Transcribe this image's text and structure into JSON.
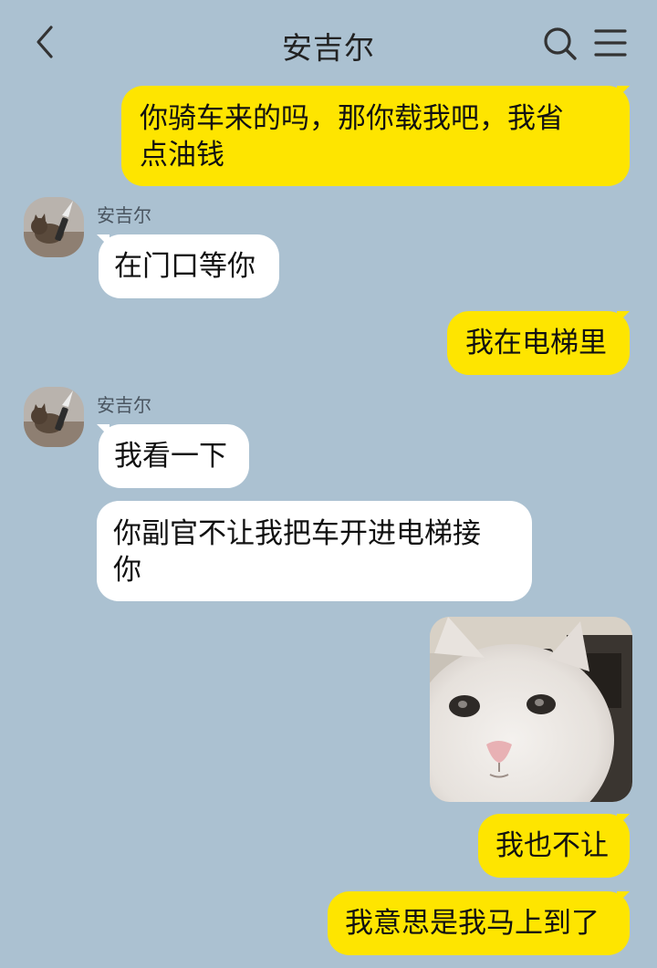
{
  "header": {
    "title": "安吉尔",
    "back_icon": "chevron-left-icon",
    "search_icon": "search-icon",
    "menu_icon": "hamburger-menu-icon"
  },
  "colors": {
    "background": "#abc1d1",
    "my_bubble": "#fee500",
    "their_bubble": "#ffffff"
  },
  "messages": [
    {
      "from": "me",
      "lines": [
        "你骑车来的吗，那你载我吧，我省",
        "点油钱"
      ]
    },
    {
      "from": "them",
      "sender": "安吉尔",
      "lines": [
        "在门口等你"
      ]
    },
    {
      "from": "me",
      "lines": [
        "我在电梯里"
      ]
    },
    {
      "from": "them",
      "sender": "安吉尔",
      "lines": [
        "我看一下"
      ]
    },
    {
      "from": "them",
      "lines": [
        "你副官不让我把车开进电梯接",
        "你"
      ]
    },
    {
      "from": "me",
      "type": "image",
      "image": "white-cat-meme"
    },
    {
      "from": "me",
      "lines": [
        "我也不让"
      ]
    },
    {
      "from": "me",
      "lines": [
        "我意思是我马上到了"
      ]
    }
  ]
}
